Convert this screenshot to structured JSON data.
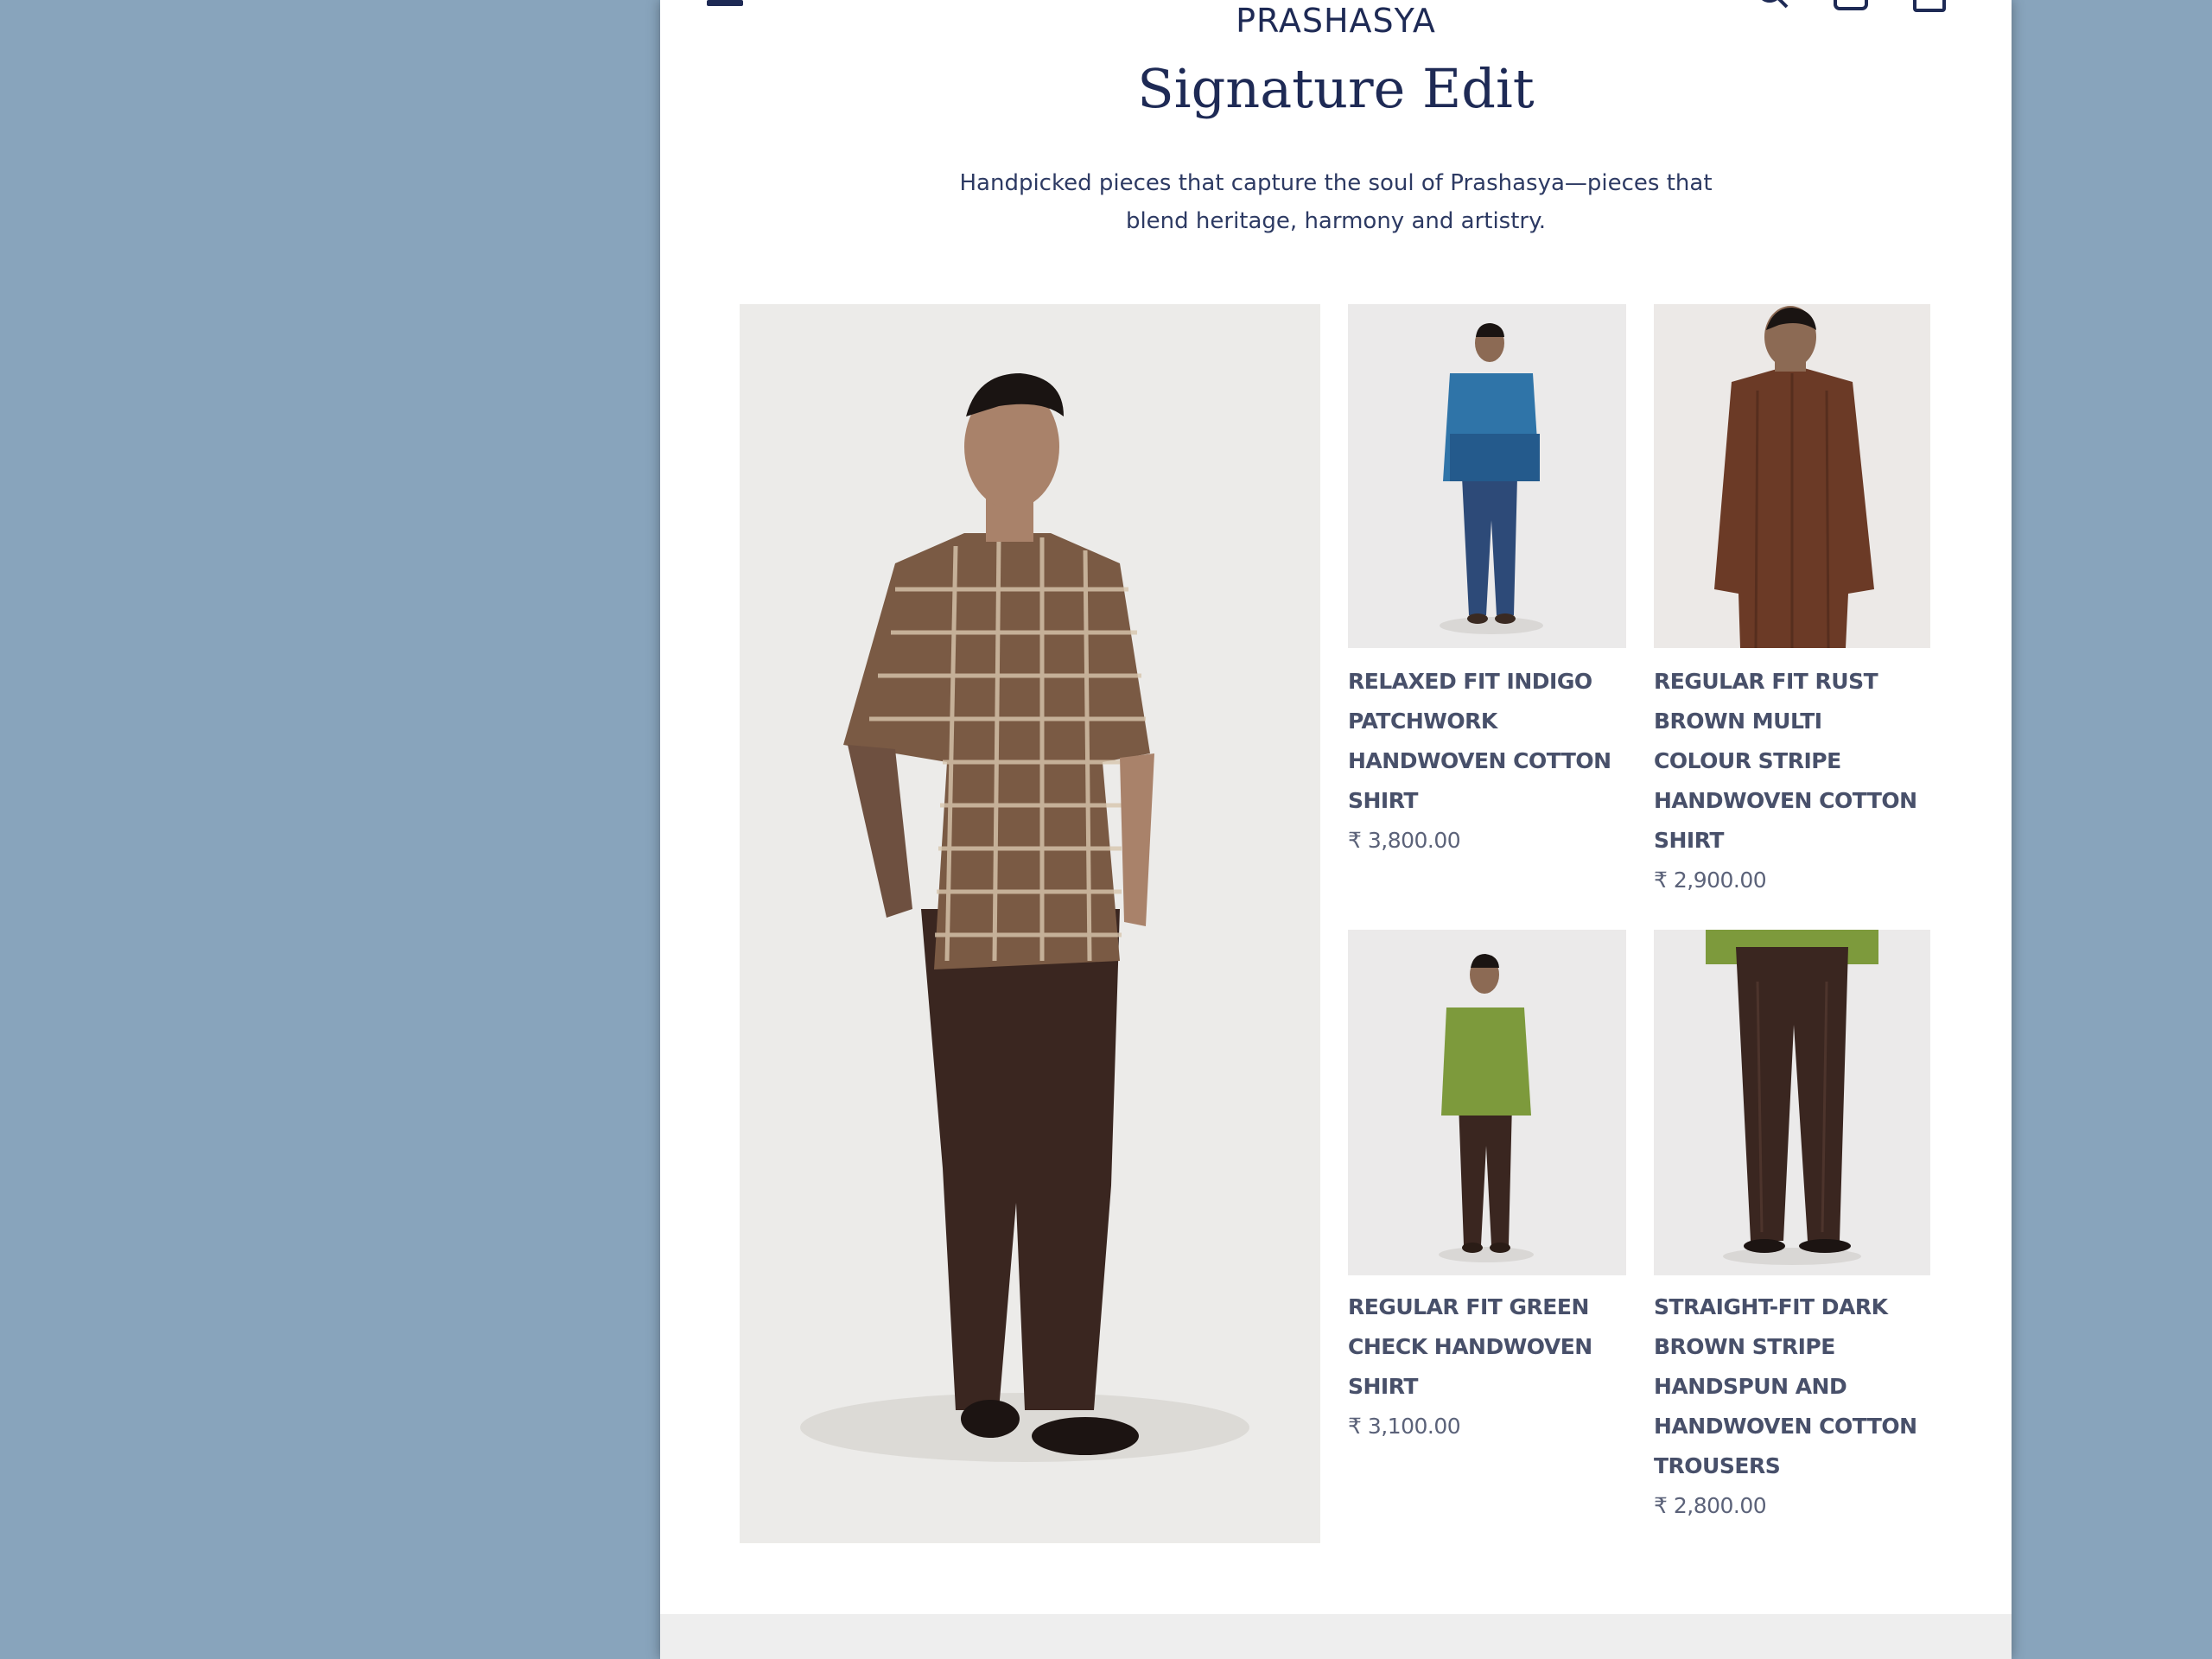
{
  "header": {
    "brand": "PRASHASYA",
    "menu_icon": "hamburger-menu-icon",
    "search_icon": "search-icon",
    "account_icon": "user-icon",
    "cart_icon": "cart-icon"
  },
  "section": {
    "title": "Signature Edit",
    "description_line1": "Handpicked pieces that capture the soul of Prashasya—pieces that",
    "description_line2": "blend heritage, harmony and artistry."
  },
  "products": [
    {
      "name_lines": [
        "RELAXED FIT INDIGO",
        "PATCHWORK",
        "HANDWOVEN COTTON",
        "SHIRT"
      ],
      "price": "₹ 3,800.00"
    },
    {
      "name_lines": [
        "REGULAR FIT RUST",
        "BROWN MULTI",
        "COLOUR STRIPE",
        "HANDWOVEN COTTON",
        "SHIRT"
      ],
      "price": "₹ 2,900.00"
    },
    {
      "name_lines": [
        "REGULAR FIT GREEN",
        "CHECK HANDWOVEN",
        "SHIRT"
      ],
      "price": "₹ 3,100.00"
    },
    {
      "name_lines": [
        "STRAIGHT-FIT DARK",
        "BROWN STRIPE",
        "HANDSPUN AND",
        "HANDWOVEN COTTON",
        "TROUSERS"
      ],
      "price": "₹ 2,800.00"
    }
  ],
  "colors": {
    "backdrop": "#88a4bc",
    "brand_navy": "#1e2a55",
    "product_text": "#48506a",
    "image_bg": "#ecebe9"
  }
}
